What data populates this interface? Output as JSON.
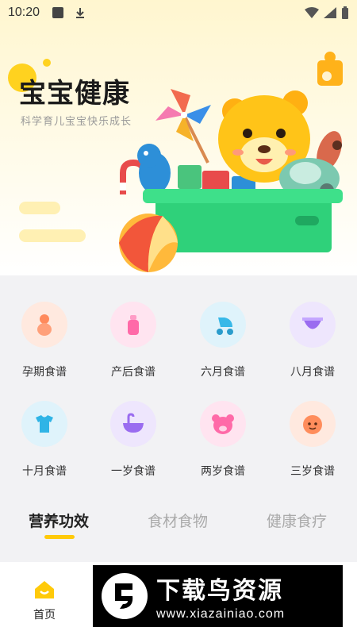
{
  "status_bar": {
    "time": "10:20"
  },
  "banner": {
    "title": "宝宝健康",
    "subtitle": "科学育儿宝宝快乐成长"
  },
  "grid": {
    "items": [
      {
        "label": "孕期食谱",
        "icon": "pregnant-icon",
        "color": "#ff9a7a"
      },
      {
        "label": "产后食谱",
        "icon": "baby-bottle-icon",
        "color": "#ff6aa8"
      },
      {
        "label": "六月食谱",
        "icon": "stroller-icon",
        "color": "#37b8e8"
      },
      {
        "label": "八月食谱",
        "icon": "diaper-icon",
        "color": "#9a6cf0"
      },
      {
        "label": "十月食谱",
        "icon": "baby-clothes-icon",
        "color": "#2fb4e6"
      },
      {
        "label": "一岁食谱",
        "icon": "bathtub-icon",
        "color": "#9a6cf0"
      },
      {
        "label": "两岁食谱",
        "icon": "bear-icon",
        "color": "#ff6aa8"
      },
      {
        "label": "三岁食谱",
        "icon": "baby-face-icon",
        "color": "#ff8d5c"
      }
    ]
  },
  "tabs": [
    {
      "label": "营养功效",
      "active": true
    },
    {
      "label": "食材食物",
      "active": false
    },
    {
      "label": "健康食疗",
      "active": false
    }
  ],
  "bottom_nav": {
    "home_label": "首页",
    "accent": "#ffca0a"
  },
  "watermark": {
    "title": "下载鸟资源",
    "url": "www.xiazainiao.com"
  }
}
